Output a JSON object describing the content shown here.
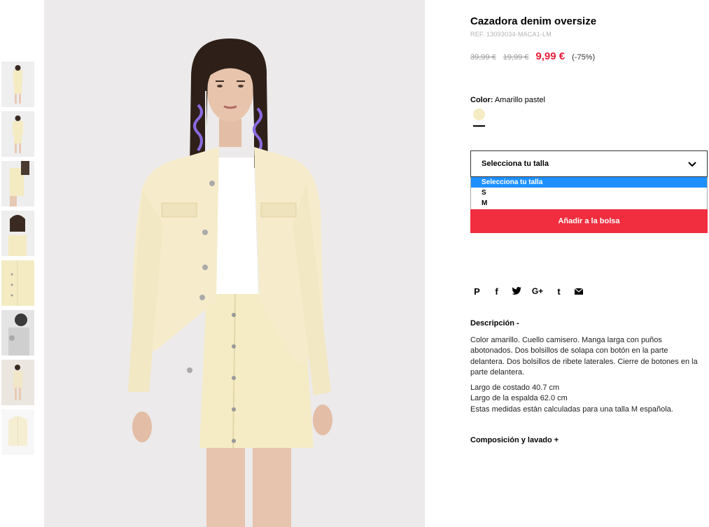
{
  "product": {
    "title": "Cazadora denim oversize",
    "ref": "REF. 13093034-MACA1-LM",
    "price_original": "39,99 €",
    "price_previous": "19,99 €",
    "price_current": "9,99 €",
    "discount": "(-75%)"
  },
  "color": {
    "label": "Color:",
    "value": "Amarillo pastel",
    "swatch_hex": "#f6ecc4"
  },
  "size": {
    "select_label": "Selecciona tu talla",
    "options": [
      "Selecciona tu talla",
      "S",
      "M"
    ]
  },
  "add_to_bag": "Añadir a la bolsa",
  "social_icons": [
    "pinterest-icon",
    "facebook-icon",
    "twitter-icon",
    "google-plus-icon",
    "tumblr-icon",
    "mail-icon"
  ],
  "social_glyphs": [
    "P",
    "f",
    "🐦",
    "G+",
    "t",
    "✉"
  ],
  "description": {
    "title": "Descripción -",
    "text": "Color amarillo. Cuello camisero. Manga larga con puños abotonados. Dos bolsillos de solapa con botón en la parte delantera. Dos bolsillos de ribete laterales. Cierre de botones en la parte delantera.",
    "measures": [
      "Largo de costado 40.7 cm",
      "Largo de la espalda 62.0 cm",
      "Estas medidas están calculadas para una talla M española."
    ]
  },
  "composition_title": "Composición y lavado +",
  "colors": {
    "accent_red": "#f02e3f",
    "price_red": "#e3203a",
    "dropdown_highlight": "#1e90ff"
  }
}
